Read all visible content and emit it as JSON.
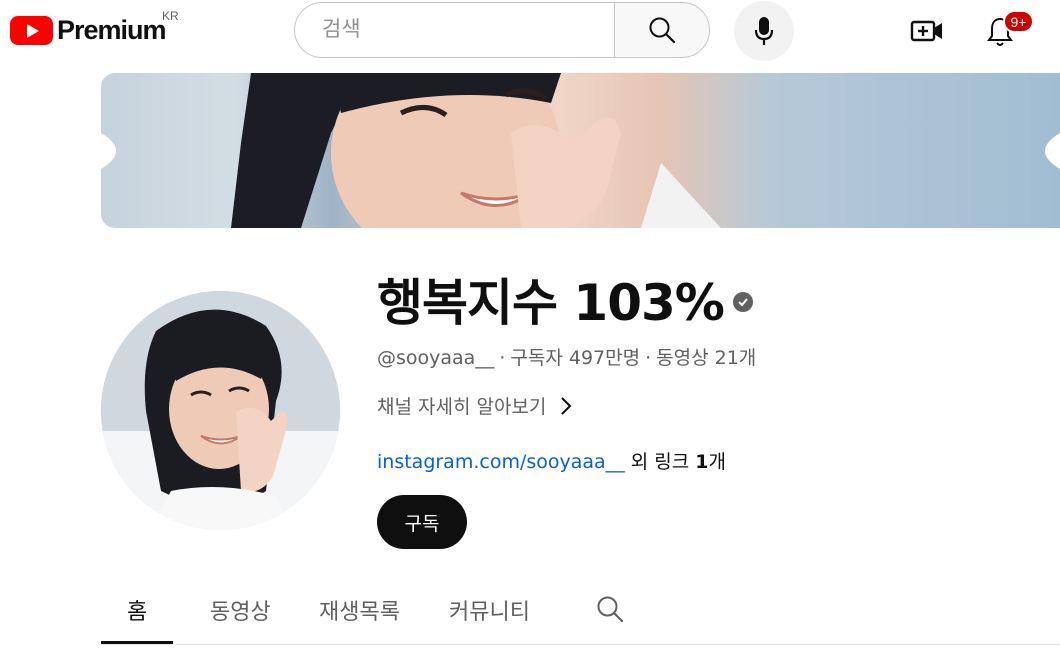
{
  "header": {
    "logo_text": "Premium",
    "country_code": "KR",
    "search_placeholder": "검색",
    "notification_count": "9+",
    "icons": {
      "search": "search-icon",
      "mic": "mic-icon",
      "create": "create-video-icon",
      "notifications": "bell-icon"
    }
  },
  "banner": {
    "image": "channel-banner-portrait"
  },
  "channel": {
    "name": "행복지수 103%",
    "verified": true,
    "handle": "@sooyaaa__",
    "subscribers": "구독자 497만명",
    "videos": "동영상 21개",
    "separator": "·",
    "about_label": "채널 자세히 알아보기",
    "link_text": "instagram.com/sooyaaa__",
    "link_suffix": " 외 링크 ",
    "link_count": "1",
    "link_suffix2": "개",
    "subscribe_label": "구독"
  },
  "tabs": [
    {
      "label": "홈",
      "active": true
    },
    {
      "label": "동영상",
      "active": false
    },
    {
      "label": "재생목록",
      "active": false
    },
    {
      "label": "커뮤니티",
      "active": false
    }
  ],
  "colors": {
    "brand_red": "#ff0000",
    "badge_red": "#cc0000",
    "link_blue": "#065fd4",
    "text_primary": "#0f0f0f",
    "text_secondary": "#606060"
  }
}
